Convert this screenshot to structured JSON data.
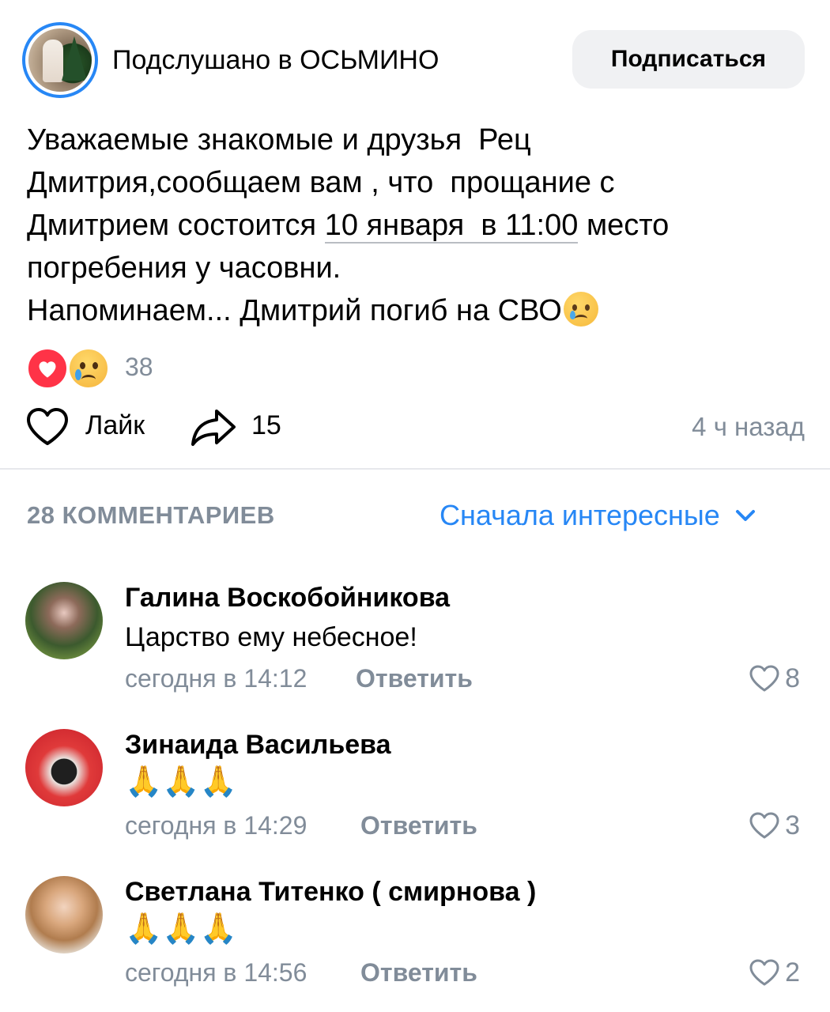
{
  "header": {
    "group_name": "Подслушано в ОСЬМИНО",
    "subscribe_label": "Подписаться"
  },
  "post": {
    "lines": [
      "Уважаемые знакомые и друзья  Рец",
      "Дмитрия,сообщаем вам , что  прощание с",
      "Дмитрием состоится ",
      "10 января  в 11:00",
      " место",
      "погребения у часовни.",
      "Напоминаем... Дмитрий погиб на СВО"
    ],
    "reactions_count": "38",
    "like_label": "Лайк",
    "share_count": "15",
    "time": "4 ч назад"
  },
  "comments_header": {
    "count_label": "28 КОММЕНТАРИЕВ",
    "sort_label": "Сначала интересные"
  },
  "comments": [
    {
      "name": "Галина Воскобойникова",
      "text": "Царство ему небесное!",
      "time": "сегодня в 14:12",
      "reply": "Ответить",
      "likes": "8"
    },
    {
      "name": "Зинаида Васильева",
      "text": "🙏🙏🙏",
      "time": "сегодня в 14:29",
      "reply": "Ответить",
      "likes": "3"
    },
    {
      "name": "Светлана Титенко ( смирнова )",
      "text": "🙏🙏🙏",
      "time": "сегодня в 14:56",
      "reply": "Ответить",
      "likes": "2"
    }
  ],
  "icons": {
    "heart_reaction": "heart-icon",
    "cry_reaction": "crying-face-icon",
    "like": "heart-outline-icon",
    "share": "share-arrow-icon",
    "sort": "chevron-down-icon"
  },
  "colors": {
    "accent": "#2787f5",
    "secondary_text": "#818c99",
    "heart_red": "#ff3347"
  }
}
